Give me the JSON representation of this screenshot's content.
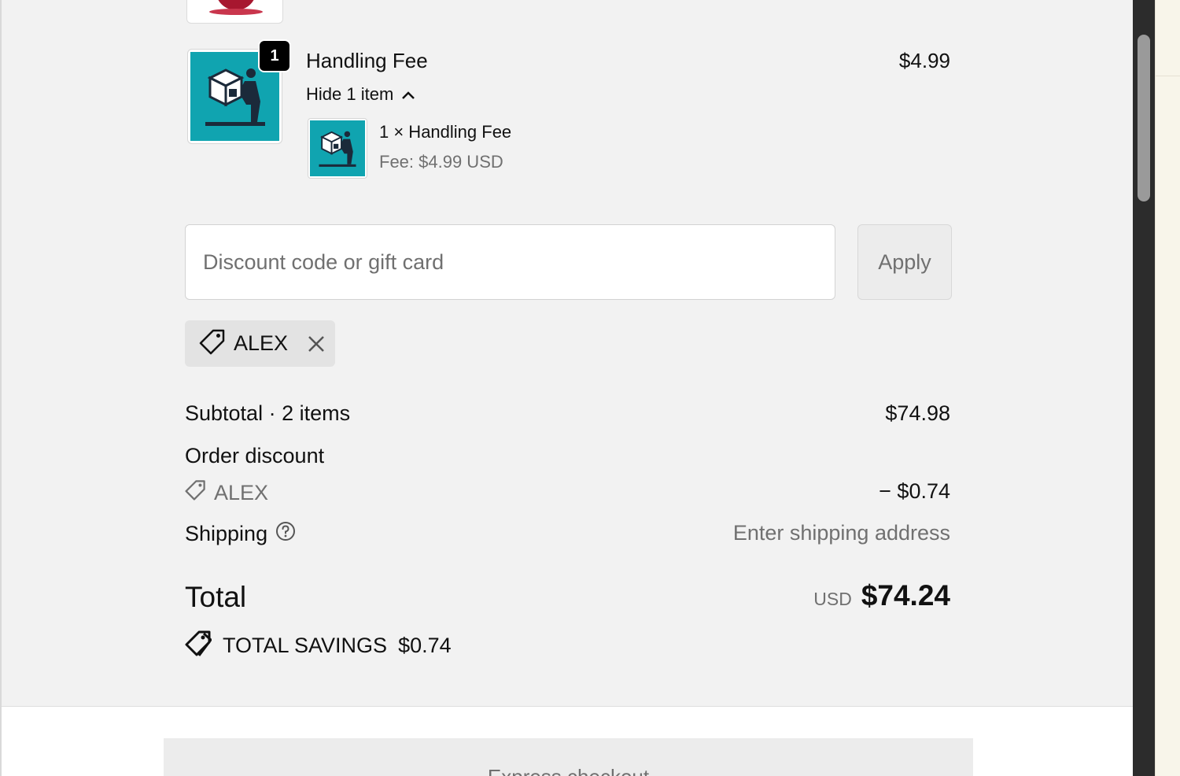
{
  "line_item": {
    "quantity_badge": "1",
    "title": "Handling Fee",
    "price": "$4.99",
    "toggle_label": "Hide 1 item",
    "sub_item": {
      "name": "1 × Handling Fee",
      "fee": "Fee: $4.99 USD"
    }
  },
  "discount": {
    "placeholder": "Discount code or gift card",
    "apply_label": "Apply",
    "applied_code": "ALEX"
  },
  "summary": {
    "subtotal_label": "Subtotal · 2 items",
    "subtotal_value": "$74.98",
    "order_discount_label": "Order discount",
    "order_discount_code": "ALEX",
    "order_discount_value": "− $0.74",
    "shipping_label": "Shipping",
    "shipping_value": "Enter shipping address",
    "total_label": "Total",
    "total_currency": "USD",
    "total_value": "$74.24",
    "savings_label": "TOTAL SAVINGS",
    "savings_value": "$0.74"
  },
  "express": {
    "label": "Express checkout"
  },
  "colors": {
    "product_tile": "#10a4b0",
    "page_background": "#f2f2f2"
  }
}
